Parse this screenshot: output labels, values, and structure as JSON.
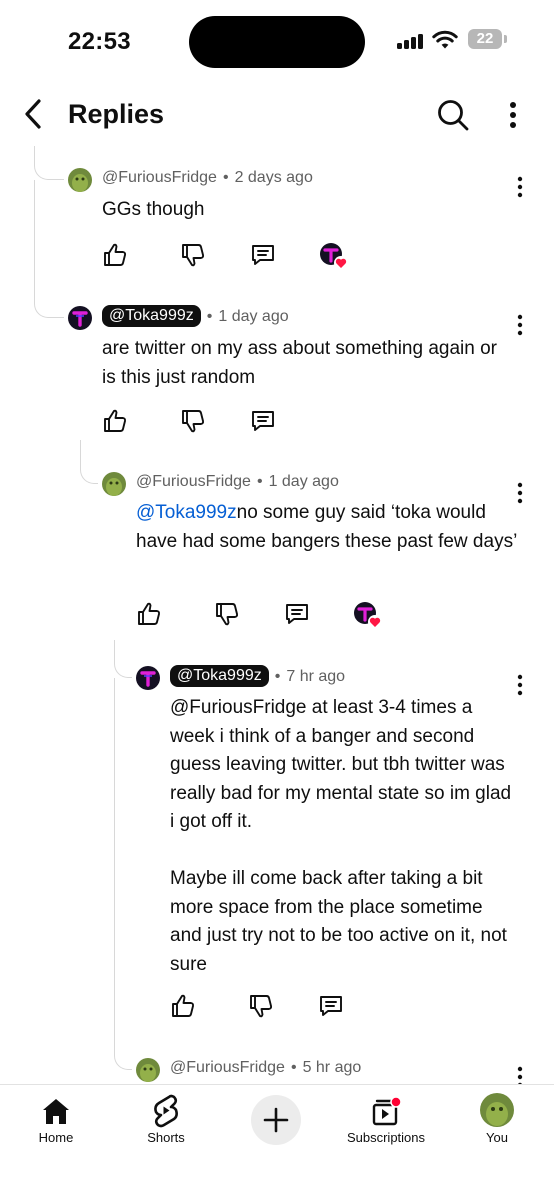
{
  "status_bar": {
    "time": "22:53",
    "battery": "22"
  },
  "header": {
    "title": "Replies"
  },
  "comments": [
    {
      "handle": "@FuriousFridge",
      "age": "2 days ago",
      "mention": "",
      "text": "GGs though"
    },
    {
      "handle": "@Toka999z",
      "age": "1 day ago",
      "mention": "",
      "text": "are twitter on my ass about something again or is this just random"
    },
    {
      "handle": "@FuriousFridge",
      "age": "1 day ago",
      "mention": "@Toka999z",
      "text": "no some guy said ‘toka would have had some bangers these past few days’"
    },
    {
      "handle": "@Toka999z",
      "age": "7 hr ago",
      "mention": "",
      "text": "@FuriousFridge at least 3-4 times a week i think of a banger and second guess leaving twitter. but tbh twitter was really bad for my mental state so im glad i got off it.\n\nMaybe ill come back after taking a bit more space from the place sometime and just try not to be too active on it, not sure"
    },
    {
      "handle": "@FuriousFridge",
      "age": "5 hr ago",
      "mention": "",
      "text": ""
    }
  ],
  "meta_separator": "•",
  "nav": {
    "items": [
      {
        "label": "Home",
        "icon": "home-icon"
      },
      {
        "label": "Shorts",
        "icon": "shorts-icon"
      },
      {
        "label": "",
        "icon": "plus-icon"
      },
      {
        "label": "Subscriptions",
        "icon": "subscriptions-icon"
      },
      {
        "label": "You",
        "icon": "avatar"
      }
    ]
  },
  "colors": {
    "mention": "#065fd4",
    "meta": "#606060",
    "heart": "#ff1744",
    "toka_avatar_accent": "#e020d8"
  }
}
